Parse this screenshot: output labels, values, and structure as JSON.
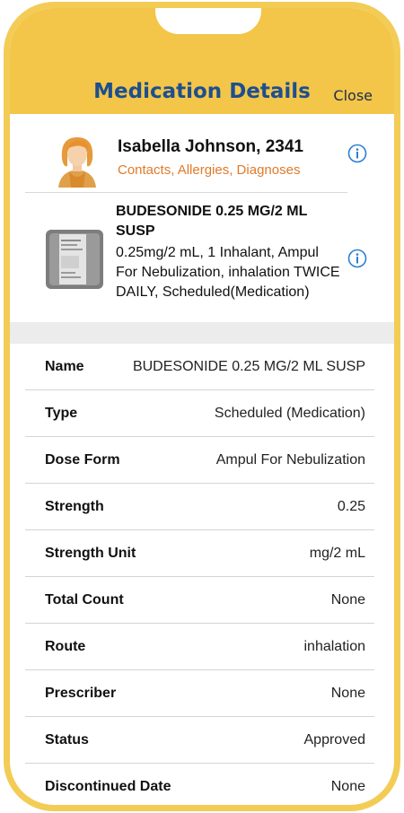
{
  "header": {
    "title": "Medication Details",
    "close_label": "Close"
  },
  "patient": {
    "name": "Isabella Johnson, 2341",
    "links": "Contacts, Allergies, Diagnoses",
    "avatar_icon": "female-avatar-icon",
    "info_icon": "info-circle-icon"
  },
  "medication": {
    "title": "BUDESONIDE 0.25 MG/2 ML SUSP",
    "description": "0.25mg/2 mL, 1 Inhalant, Ampul For Nebulization, inhalation TWICE DAILY, Scheduled(Medication)",
    "image_icon": "medication-package-icon",
    "info_icon": "info-circle-icon"
  },
  "details": [
    {
      "label": "Name",
      "value": "BUDESONIDE 0.25 MG/2 ML SUSP"
    },
    {
      "label": "Type",
      "value": "Scheduled (Medication)"
    },
    {
      "label": "Dose Form",
      "value": "Ampul For Nebulization"
    },
    {
      "label": "Strength",
      "value": "0.25"
    },
    {
      "label": "Strength Unit",
      "value": "mg/2 mL"
    },
    {
      "label": "Total Count",
      "value": "None"
    },
    {
      "label": "Route",
      "value": "inhalation"
    },
    {
      "label": "Prescriber",
      "value": "None"
    },
    {
      "label": "Status",
      "value": "Approved"
    },
    {
      "label": "Discontinued Date",
      "value": "None"
    }
  ],
  "colors": {
    "header_bg": "#f3c548",
    "frame": "#f3cc55",
    "title_blue": "#1d4f8f",
    "link_orange": "#e07a2a",
    "info_blue": "#2b7fd4"
  }
}
